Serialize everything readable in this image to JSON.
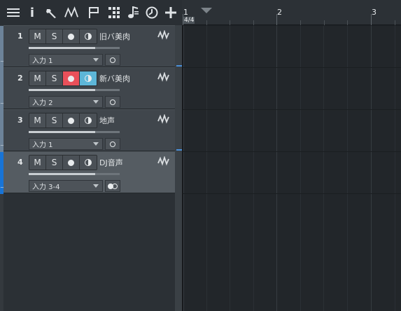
{
  "toolbar": {
    "icons": [
      "list-icon",
      "info-icon",
      "wrench-icon",
      "automation-icon",
      "flag-icon",
      "grid-icon",
      "music-note-icon",
      "clock-icon",
      "add-icon"
    ],
    "info_glyph": "i"
  },
  "ruler": {
    "bar_numbers": [
      "1",
      "2",
      "3"
    ],
    "time_signature": "4/4"
  },
  "tracks": [
    {
      "number": "1",
      "name": "旧バ美肉",
      "input": "入力 1",
      "mute": "M",
      "solo": "S",
      "record_armed": false,
      "monitor_on": false,
      "selected": false,
      "io_type": "mono",
      "fader": 0.73
    },
    {
      "number": "2",
      "name": "新バ美肉",
      "input": "入力 2",
      "mute": "M",
      "solo": "S",
      "record_armed": true,
      "monitor_on": true,
      "selected": false,
      "io_type": "mono",
      "fader": 0.73
    },
    {
      "number": "3",
      "name": "地声",
      "input": "入力 1",
      "mute": "M",
      "solo": "S",
      "record_armed": false,
      "monitor_on": false,
      "selected": false,
      "io_type": "mono",
      "fader": 0.73
    },
    {
      "number": "4",
      "name": "DJ音声",
      "input": "入力 3-4",
      "mute": "M",
      "solo": "S",
      "record_armed": false,
      "monitor_on": false,
      "selected": true,
      "io_type": "stereo",
      "fader": 0.73
    }
  ],
  "colors": {
    "record_armed": "#e8505a",
    "monitor_on": "#5db6d8",
    "selected_strip": "#1874d6",
    "track_strip": "#6d8399"
  }
}
